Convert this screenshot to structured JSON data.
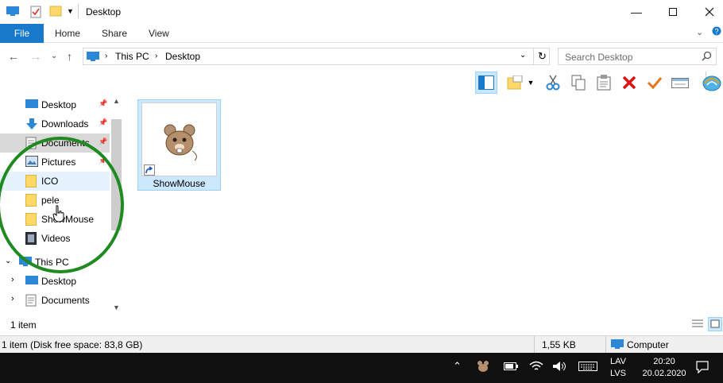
{
  "window": {
    "title": "Desktop"
  },
  "ribbon": {
    "file": "File",
    "tabs": [
      "Home",
      "Share",
      "View"
    ]
  },
  "address": {
    "segments": [
      "This PC",
      "Desktop"
    ]
  },
  "search": {
    "placeholder": "Search Desktop"
  },
  "nav": {
    "items": [
      {
        "label": "Desktop",
        "icon": "desktop-icon",
        "pinned": true
      },
      {
        "label": "Downloads",
        "icon": "download-icon",
        "pinned": true
      },
      {
        "label": "Documents",
        "icon": "documents-icon",
        "pinned": true
      },
      {
        "label": "Pictures",
        "icon": "pictures-icon",
        "pinned": true
      },
      {
        "label": "ICO",
        "icon": "folder-icon"
      },
      {
        "label": "pele",
        "icon": "folder-icon"
      },
      {
        "label": "ShowMouse",
        "icon": "folder-icon"
      },
      {
        "label": "Videos",
        "icon": "videos-icon"
      },
      {
        "label": "This PC",
        "icon": "computer-icon"
      },
      {
        "label": "Desktop",
        "icon": "desktop-icon"
      },
      {
        "label": "Documents",
        "icon": "documents-icon"
      }
    ]
  },
  "content": {
    "file_name": "ShowMouse"
  },
  "status": {
    "item_count": "1 item",
    "details": "1 item (Disk free space: 83,8 GB)",
    "size": "1,55 KB",
    "location": "Computer"
  },
  "taskbar": {
    "lang_top": "LAV",
    "lang_bottom": "LVS",
    "time": "20:20",
    "date": "20.02.2020"
  },
  "colors": {
    "accent": "#1979ca",
    "selection": "#cce8ff",
    "annotation": "#1f8a1f"
  }
}
